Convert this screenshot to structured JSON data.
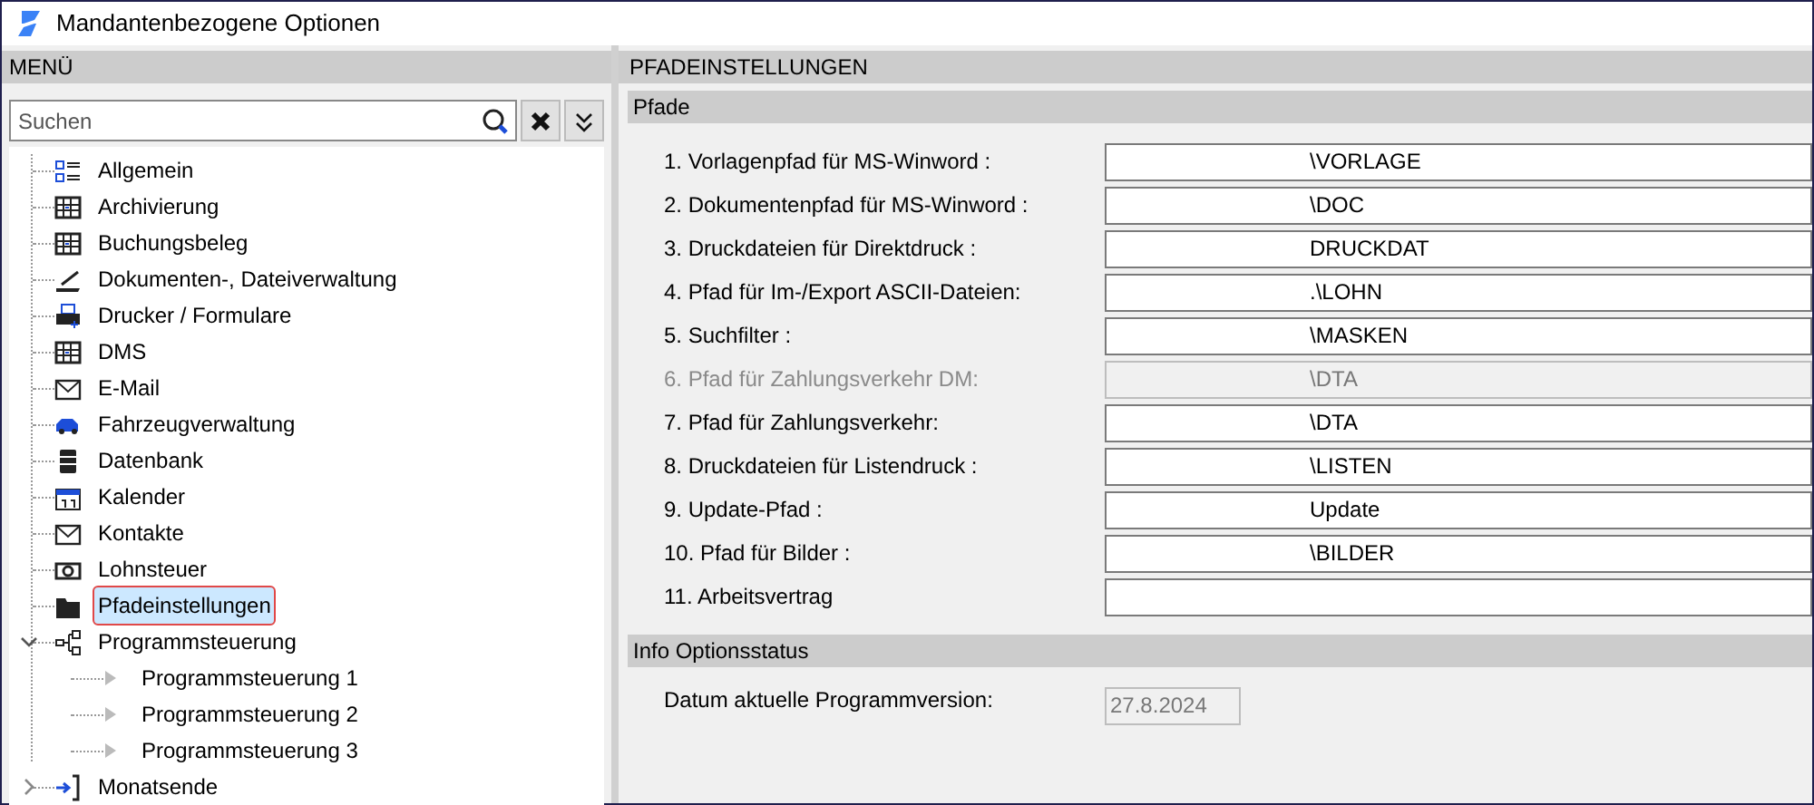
{
  "window": {
    "title": "Mandantenbezogene Optionen"
  },
  "menu": {
    "header": "MENÜ",
    "search": {
      "placeholder": "Suchen"
    },
    "tree": [
      {
        "label": "Allgemein",
        "selected": false
      },
      {
        "label": "Archivierung",
        "selected": false
      },
      {
        "label": "Buchungsbeleg",
        "selected": false
      },
      {
        "label": "Dokumenten-, Dateiverwaltung",
        "selected": false
      },
      {
        "label": "Drucker / Formulare",
        "selected": false
      },
      {
        "label": "DMS",
        "selected": false
      },
      {
        "label": "E-Mail",
        "selected": false
      },
      {
        "label": "Fahrzeugverwaltung",
        "selected": false
      },
      {
        "label": "Datenbank",
        "selected": false
      },
      {
        "label": "Kalender",
        "selected": false
      },
      {
        "label": "Kontakte",
        "selected": false
      },
      {
        "label": "Lohnsteuer",
        "selected": false
      },
      {
        "label": "Pfadeinstellungen",
        "selected": true
      },
      {
        "label": "Programmsteuerung",
        "selected": false,
        "expanded": true,
        "children": [
          {
            "label": "Programmsteuerung 1",
            "selected": false
          },
          {
            "label": "Programmsteuerung 2",
            "selected": false
          },
          {
            "label": "Programmsteuerung 3",
            "selected": false
          }
        ]
      },
      {
        "label": "Monatsende",
        "selected": false,
        "expanded": false
      }
    ]
  },
  "content": {
    "header": "PFADEINSTELLUNGEN",
    "sections": [
      {
        "title": "Pfade",
        "fields": [
          {
            "label": "1. Vorlagenpfad für MS-Winword :",
            "value": "\\VORLAGE",
            "disabled": false
          },
          {
            "label": "2. Dokumentenpfad für MS-Winword :",
            "value": "\\DOC",
            "disabled": false
          },
          {
            "label": "3. Druckdateien für Direktdruck :",
            "value": "DRUCKDAT",
            "disabled": false
          },
          {
            "label": "4. Pfad für Im-/Export ASCII-Dateien:",
            "value": ".\\LOHN",
            "disabled": false
          },
          {
            "label": "5. Suchfilter :",
            "value": "\\MASKEN",
            "disabled": false
          },
          {
            "label": "6. Pfad für Zahlungsverkehr DM:",
            "value": "\\DTA",
            "disabled": true
          },
          {
            "label": "7. Pfad für Zahlungsverkehr:",
            "value": "\\DTA",
            "disabled": false
          },
          {
            "label": "8. Druckdateien für Listendruck :",
            "value": "\\LISTEN",
            "disabled": false
          },
          {
            "label": "9. Update-Pfad :",
            "value": "Update",
            "disabled": false
          },
          {
            "label": "10. Pfad für Bilder :",
            "value": "\\BILDER",
            "disabled": false
          },
          {
            "label": "11. Arbeitsvertrag",
            "disabled": false
          }
        ]
      },
      {
        "title": "Info Optionsstatus",
        "fields": [
          {
            "label": "Datum aktuelle Programmversion:",
            "value": "27.8.2024",
            "disabled": true,
            "kind": "short"
          }
        ]
      }
    ]
  }
}
